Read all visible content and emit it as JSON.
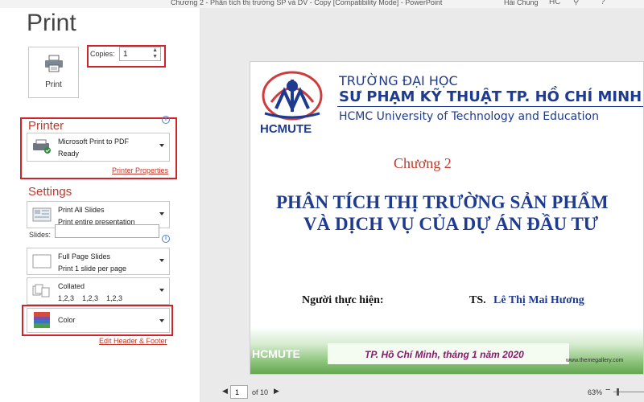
{
  "window": {
    "title": "Chương 2 - Phân tích thị trường SP và DV - Copy [Compatibility Mode] - PowerPoint",
    "user": "Hải Chung",
    "user_initials": "HC"
  },
  "left": {
    "page_title": "Print",
    "print_button": "Print",
    "copies": {
      "label": "Copies:",
      "value": "1"
    },
    "printer": {
      "heading": "Printer",
      "name": "Microsoft Print to PDF",
      "status": "Ready",
      "properties_link": "Printer Properties"
    },
    "settings": {
      "heading": "Settings",
      "range": {
        "line1": "Print All Slides",
        "line2": "Print entire presentation"
      },
      "slides_label": "Slides:",
      "slides_value": "",
      "layout": {
        "line1": "Full Page Slides",
        "line2": "Print 1 slide per page"
      },
      "collation": {
        "line1": "Collated",
        "line2": "1,2,3    1,2,3    1,2,3"
      },
      "color": {
        "line1": "Color"
      },
      "edit_link": "Edit Header & Footer"
    }
  },
  "preview": {
    "logo_text": "HCMUTE",
    "university_line1": "TRƯỜNG ĐẠI HỌC",
    "university_line2": "SƯ PHẠM KỸ THUẬT TP. HỒ CHÍ MINH",
    "university_line3": "HCMC University of Technology and Education",
    "chapter": "Chương 2",
    "heading_line1": "PHÂN TÍCH THỊ TRƯỜNG SẢN PHẨM",
    "heading_line2": "VÀ DỊCH VỤ CỦA DỰ ÁN ĐẦU TƯ",
    "author_label": "Người thực hiện:",
    "author_title": "TS.",
    "author_name": "Lê Thị Mai Hương",
    "date": "TP. Hồ Chí Minh, tháng 1 năm 2020",
    "footer_logo": "HCMUTE",
    "watermark": "www.themegallery.com"
  },
  "pager": {
    "current": "1",
    "of_text": "of 10",
    "zoom": "63%"
  },
  "colors": {
    "accent": "#c0392b",
    "highlight_box": "#d1232a",
    "slide_blue": "#1f3b8f"
  }
}
